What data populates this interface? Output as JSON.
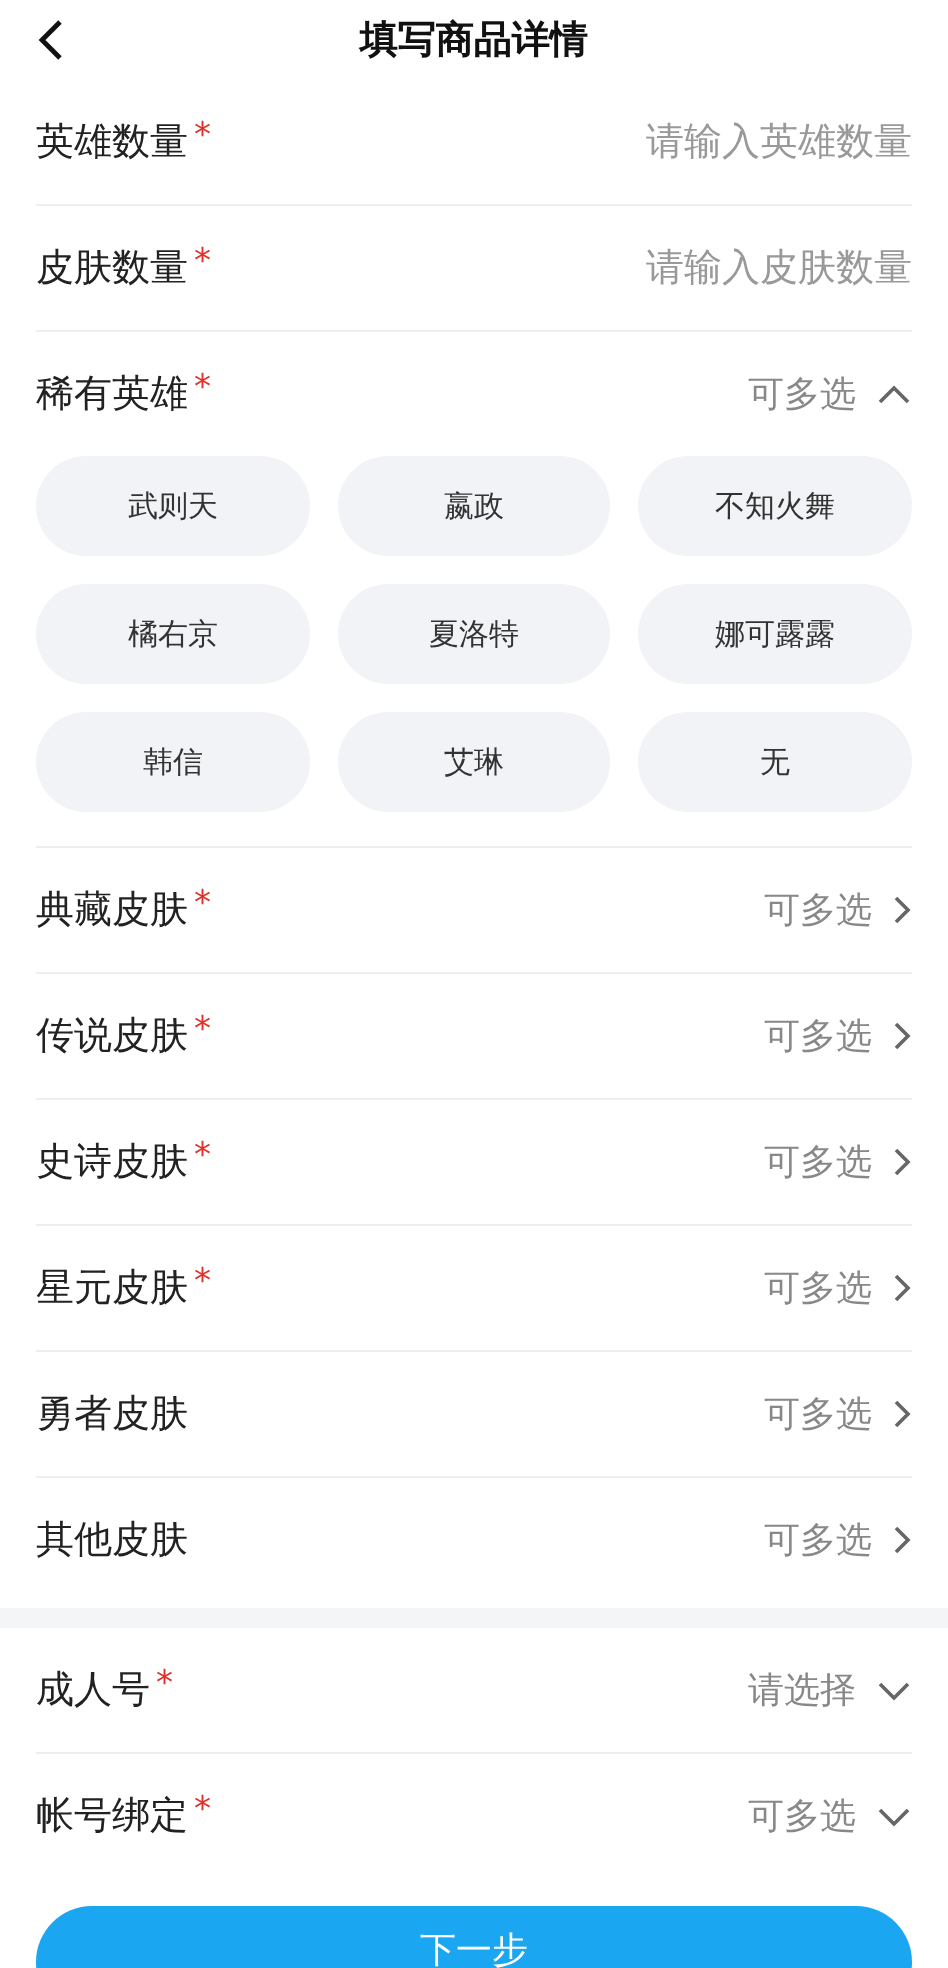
{
  "header": {
    "title": "填写商品详情"
  },
  "sections": [
    {
      "rows": [
        {
          "kind": "input",
          "label": "英雄数量",
          "required_mark": "*",
          "placeholder": "请输入英雄数量"
        },
        {
          "kind": "input",
          "label": "皮肤数量",
          "required_mark": "*",
          "placeholder": "请输入皮肤数量"
        },
        {
          "kind": "dropdown",
          "label": "稀有英雄",
          "required_mark": "*",
          "value": "可多选",
          "expanded": true,
          "options": [
            "武则天",
            "嬴政",
            "不知火舞",
            "橘右京",
            "夏洛特",
            "娜可露露",
            "韩信",
            "艾琳",
            "无"
          ]
        },
        {
          "kind": "link",
          "label": "典藏皮肤",
          "required_mark": "*",
          "value": "可多选"
        },
        {
          "kind": "link",
          "label": "传说皮肤",
          "required_mark": "*",
          "value": "可多选"
        },
        {
          "kind": "link",
          "label": "史诗皮肤",
          "required_mark": "*",
          "value": "可多选"
        },
        {
          "kind": "link",
          "label": "星元皮肤",
          "required_mark": "*",
          "value": "可多选"
        },
        {
          "kind": "link",
          "label": "勇者皮肤",
          "value": "可多选"
        },
        {
          "kind": "link",
          "label": "其他皮肤",
          "value": "可多选"
        }
      ]
    },
    {
      "rows": [
        {
          "kind": "dropdown",
          "label": "成人号",
          "required_mark": "*",
          "value": "请选择",
          "expanded": false
        },
        {
          "kind": "dropdown",
          "label": "帐号绑定",
          "required_mark": "*",
          "value": "可多选",
          "expanded": false
        }
      ]
    }
  ],
  "button": {
    "label": "下一步"
  }
}
